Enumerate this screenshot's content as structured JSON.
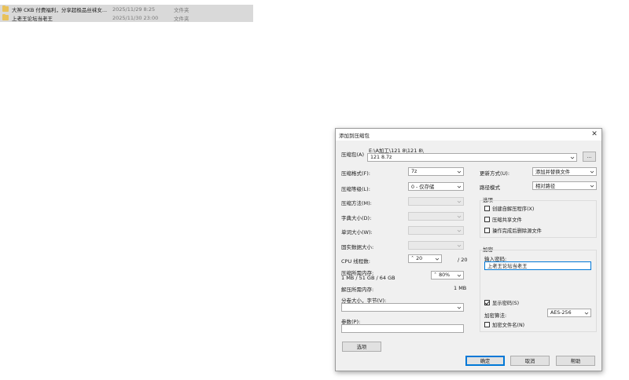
{
  "explorer": {
    "rows": [
      {
        "name": "大神 CKB 付费福利，分享超极品丝袜女...",
        "date": "2025/11/29 8:25",
        "type": "文件夹"
      },
      {
        "name": "上老王论坛当老王",
        "date": "2025/11/30 23:00",
        "type": "文件夹"
      }
    ]
  },
  "dialog": {
    "title": "添加到压缩包",
    "close": "✕",
    "archive_label": "压缩包(A)",
    "archive_path": "E:\\A加工\\121 8\\121 8\\",
    "archive_name": "121 8.7z",
    "browse_label": "...",
    "format_label": "压缩格式(F):",
    "format_value": "7z",
    "level_label": "压缩等级(L):",
    "level_value": "0 - 仅存储",
    "method_label": "压缩方法(M):",
    "dict_label": "字典大小(D):",
    "word_label": "单词大小(W):",
    "solid_label": "固实数据大小:",
    "cpu_label": "CPU 线程数:",
    "cpu_value": "20",
    "cpu_total": "/ 20",
    "mem_label": "压缩所需内存:",
    "mem_detail": "1 MB / 51 GB / 64 GB",
    "mem_pct": "80%",
    "decomp_label": "解压所需内存:",
    "decomp_value": "1 MB",
    "split_label": "分卷大小，字节(V):",
    "params_label": "参数(P):",
    "options_button": "选项",
    "update_label": "更新方式(U):",
    "update_value": "添加并替换文件",
    "path_label": "路径模式",
    "path_value": "相对路径",
    "options_group": "选项",
    "opt_sfx": "创建自解压程序(X)",
    "opt_shared": "压缩共享文件",
    "opt_delete": "操作完成后删除源文件",
    "encrypt_group": "加密",
    "password_label": "输入密码:",
    "password_value": "上老王论坛当老王",
    "show_password": "显示密码(S)",
    "enc_method_label": "加密算法:",
    "enc_method_value": "AES-256",
    "encrypt_names": "加密文件名(N)",
    "ok": "确定",
    "cancel": "取消",
    "help": "帮助"
  }
}
